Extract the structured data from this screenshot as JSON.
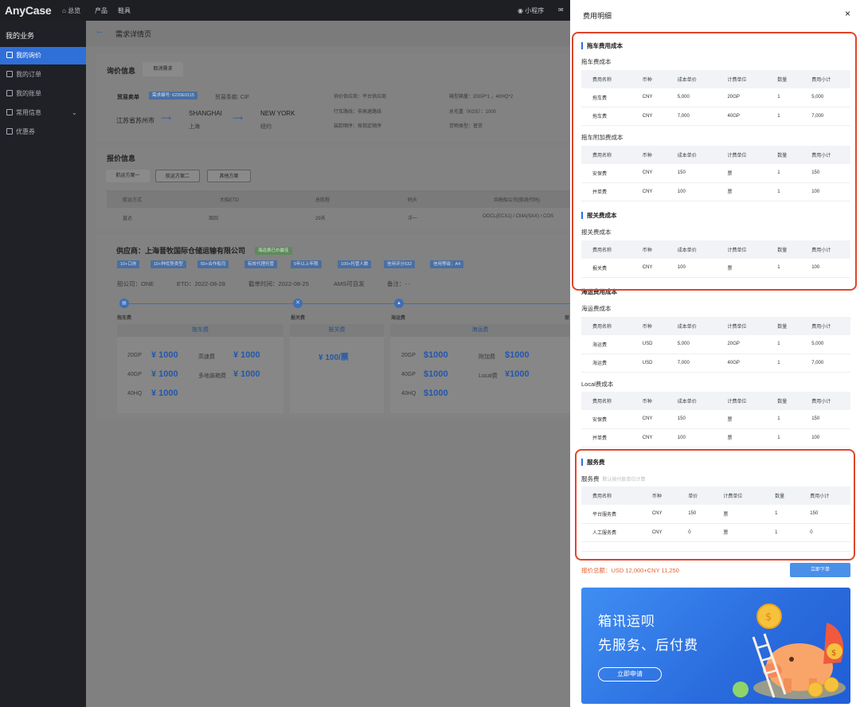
{
  "app": {
    "logo": "AnyCase",
    "nav": [
      "总览",
      "产品",
      "鞋具"
    ],
    "mini_program": "小程序"
  },
  "sidebar": {
    "title": "我的业务",
    "items": [
      {
        "label": "我的询价",
        "active": true
      },
      {
        "label": "我的订单"
      },
      {
        "label": "我的账单"
      },
      {
        "label": "常用信息"
      },
      {
        "label": "优惠券"
      }
    ]
  },
  "page": {
    "title": "需求详情页",
    "inquiry": {
      "heading": "询价信息",
      "cancel_btn": "取消需求",
      "trade": "贸易卖单",
      "req_no": "需求编号: 6220E0115",
      "terms": "贸易条款: CIF",
      "origin_city": "江苏省苏州市",
      "pol": "SHANGHAI",
      "pol_cn": "上海",
      "pod": "NEW YORK",
      "pod_cn": "纽约",
      "supplier_src": "询价供应商：平台供应商",
      "route": "行车路线：非高速路线",
      "load_seq": "装卸顺序：按指定顺序",
      "box": "箱型箱量：20GP*1 ，40HQ*2",
      "weight": "总毛重（KGS）：1000",
      "cargo": "货物类型：普货"
    },
    "quote": {
      "heading": "报价信息",
      "tabs": [
        "航运方案一",
        "航运方案二",
        "其他方案"
      ],
      "cols": [
        "航运方式",
        "大船ETD",
        "总航程",
        "码头",
        "共舱船公司(航线代码)"
      ],
      "row": [
        "直达",
        "周四",
        "29天",
        "洋一",
        "OOCL(ECX1) / CMA(SAX) / COS"
      ]
    },
    "supplier": {
      "name": "供应商：上海晋牧国际仓储运输有限公司",
      "badge": "海运费已价最佳",
      "tags": [
        "10+口岸",
        "10+种优势类型",
        "50+合作船司",
        "有效代理托管",
        "5年以上年限",
        "100+托管人数",
        "信用评分632",
        "信用等级：A4"
      ],
      "line": [
        "船公司：ONE",
        "ETD：2022-08-28",
        "截单时间：2022-08-25",
        "AMS可自发",
        "备注：- -"
      ],
      "steps": [
        "拖车费",
        "报关费",
        "海运费",
        "保"
      ],
      "tow": {
        "title": "拖车费",
        "rows": [
          [
            "20GP",
            "¥ 1000",
            "高速费",
            "¥ 1000"
          ],
          [
            "40GP",
            "¥ 1000",
            "多地装箱费",
            "¥ 1000"
          ],
          [
            "40HQ",
            "¥ 1000",
            "",
            ""
          ]
        ]
      },
      "customs": {
        "title": "报关费",
        "price": "¥ 100/票"
      },
      "ocean": {
        "title": "海运费",
        "rows": [
          [
            "20GP",
            "$1000",
            "附加费",
            "$1000"
          ],
          [
            "40GP",
            "$1000",
            "Local费",
            "¥1000"
          ],
          [
            "40HQ",
            "$1000",
            "",
            ""
          ]
        ]
      }
    }
  },
  "drawer": {
    "title": "费用明细",
    "close": "×",
    "tow_section": "拖车费用成本",
    "tow_sub": "拖车费成本",
    "cols": [
      "费用名称",
      "币种",
      "成本单价",
      "计费单位",
      "数量",
      "费用小计"
    ],
    "tow_rows": [
      [
        "拖车费",
        "CNY",
        "5,000",
        "20GP",
        "1",
        "5,000"
      ],
      [
        "拖车费",
        "CNY",
        "7,000",
        "40GP",
        "1",
        "7,000"
      ]
    ],
    "tow_add_sub": "拖车附加费成本",
    "tow_add_rows": [
      [
        "安保费",
        "CNY",
        "150",
        "票",
        "1",
        "150"
      ],
      [
        "并单费",
        "CNY",
        "100",
        "票",
        "1",
        "100"
      ]
    ],
    "customs_section": "报关费成本",
    "customs_sub": "报关费成本",
    "customs_rows": [
      [
        "报关费",
        "CNY",
        "100",
        "票",
        "1",
        "100"
      ]
    ],
    "ocean_section": "海运费用成本",
    "ocean_sub": "海运费成本",
    "ocean_rows": [
      [
        "海运费",
        "USD",
        "5,000",
        "20GP",
        "1",
        "5,000"
      ],
      [
        "海运费",
        "USD",
        "7,000",
        "40GP",
        "1",
        "7,000"
      ]
    ],
    "local_sub": "Local费成本",
    "local_rows": [
      [
        "安保费",
        "CNY",
        "150",
        "票",
        "1",
        "150"
      ],
      [
        "并单费",
        "CNY",
        "100",
        "票",
        "1",
        "100"
      ]
    ],
    "service_section": "服务费",
    "service_sub": "服务费",
    "service_note": "默认按付款单位计算",
    "service_cols": [
      "费用名称",
      "币种",
      "单价",
      "计费单位",
      "数量",
      "费用小计"
    ],
    "service_rows": [
      [
        "平台服务费",
        "CNY",
        "150",
        "票",
        "1",
        "150"
      ],
      [
        "人工服务费",
        "CNY",
        "0",
        "票",
        "1",
        "0"
      ]
    ],
    "total": "报价总额：USD 12,000+CNY 11,250",
    "order_btn": "立即下单",
    "banner": {
      "line1": "箱讯运呗",
      "line2": "先服务、后付费",
      "apply": "立即申请"
    }
  },
  "colors": {
    "accent": "#2f6fd8",
    "highlight": "#e0452a",
    "total": "#e6622f"
  }
}
